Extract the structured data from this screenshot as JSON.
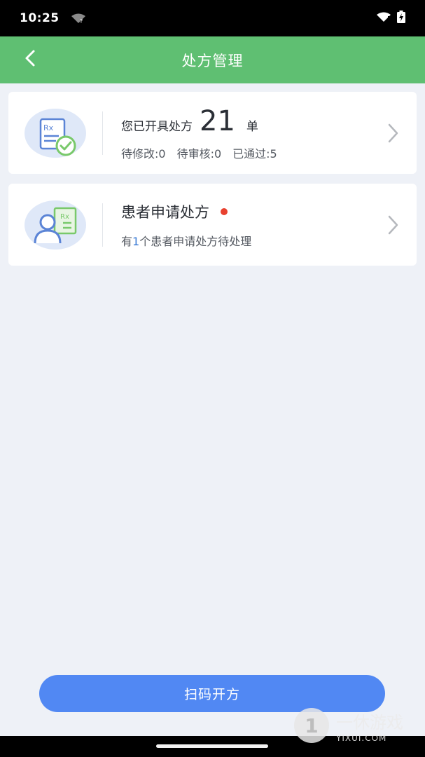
{
  "status_bar": {
    "time": "10:25",
    "icons": [
      "wifi-question-icon",
      "wifi-icon",
      "battery-charging-icon"
    ]
  },
  "nav": {
    "title": "处方管理",
    "back_icon": "chevron-left-icon"
  },
  "prescriptions_card": {
    "label": "您已开具处方",
    "count": "21",
    "unit": "单",
    "stats": [
      {
        "text": "待修改:0"
      },
      {
        "text": "待审核:0"
      },
      {
        "text": "已通过:5"
      }
    ],
    "icon": "rx-document-check-icon"
  },
  "patient_requests_card": {
    "title": "患者申请处方",
    "desc_prefix": "有",
    "desc_count": "1",
    "desc_suffix": "个患者申请处方待处理",
    "icon": "patient-rx-icon"
  },
  "scan_button": {
    "label": "扫码开方"
  },
  "watermark": {
    "cn": "一休游戏",
    "en": "YIXUI.COM"
  },
  "colors": {
    "nav_green": "#5fbf72",
    "button_blue": "#5188f3",
    "dot_red": "#e8412f",
    "background": "#eef1f7"
  }
}
